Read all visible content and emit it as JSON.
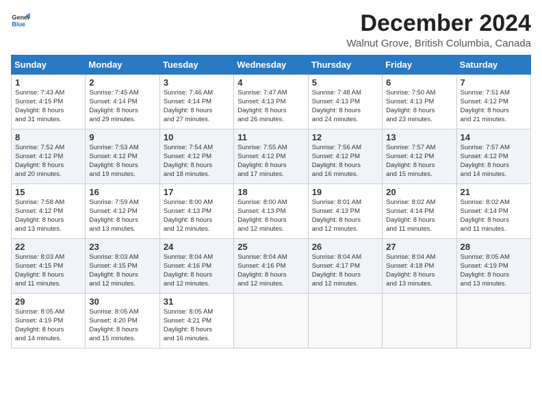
{
  "header": {
    "logo_line1": "General",
    "logo_line2": "Blue",
    "title": "December 2024",
    "subtitle": "Walnut Grove, British Columbia, Canada"
  },
  "days_of_week": [
    "Sunday",
    "Monday",
    "Tuesday",
    "Wednesday",
    "Thursday",
    "Friday",
    "Saturday"
  ],
  "weeks": [
    [
      {
        "day": 1,
        "lines": [
          "Sunrise: 7:43 AM",
          "Sunset: 4:15 PM",
          "Daylight: 8 hours",
          "and 31 minutes."
        ]
      },
      {
        "day": 2,
        "lines": [
          "Sunrise: 7:45 AM",
          "Sunset: 4:14 PM",
          "Daylight: 8 hours",
          "and 29 minutes."
        ]
      },
      {
        "day": 3,
        "lines": [
          "Sunrise: 7:46 AM",
          "Sunset: 4:14 PM",
          "Daylight: 8 hours",
          "and 27 minutes."
        ]
      },
      {
        "day": 4,
        "lines": [
          "Sunrise: 7:47 AM",
          "Sunset: 4:13 PM",
          "Daylight: 8 hours",
          "and 26 minutes."
        ]
      },
      {
        "day": 5,
        "lines": [
          "Sunrise: 7:48 AM",
          "Sunset: 4:13 PM",
          "Daylight: 8 hours",
          "and 24 minutes."
        ]
      },
      {
        "day": 6,
        "lines": [
          "Sunrise: 7:50 AM",
          "Sunset: 4:13 PM",
          "Daylight: 8 hours",
          "and 23 minutes."
        ]
      },
      {
        "day": 7,
        "lines": [
          "Sunrise: 7:51 AM",
          "Sunset: 4:12 PM",
          "Daylight: 8 hours",
          "and 21 minutes."
        ]
      }
    ],
    [
      {
        "day": 8,
        "lines": [
          "Sunrise: 7:52 AM",
          "Sunset: 4:12 PM",
          "Daylight: 8 hours",
          "and 20 minutes."
        ]
      },
      {
        "day": 9,
        "lines": [
          "Sunrise: 7:53 AM",
          "Sunset: 4:12 PM",
          "Daylight: 8 hours",
          "and 19 minutes."
        ]
      },
      {
        "day": 10,
        "lines": [
          "Sunrise: 7:54 AM",
          "Sunset: 4:12 PM",
          "Daylight: 8 hours",
          "and 18 minutes."
        ]
      },
      {
        "day": 11,
        "lines": [
          "Sunrise: 7:55 AM",
          "Sunset: 4:12 PM",
          "Daylight: 8 hours",
          "and 17 minutes."
        ]
      },
      {
        "day": 12,
        "lines": [
          "Sunrise: 7:56 AM",
          "Sunset: 4:12 PM",
          "Daylight: 8 hours",
          "and 16 minutes."
        ]
      },
      {
        "day": 13,
        "lines": [
          "Sunrise: 7:57 AM",
          "Sunset: 4:12 PM",
          "Daylight: 8 hours",
          "and 15 minutes."
        ]
      },
      {
        "day": 14,
        "lines": [
          "Sunrise: 7:57 AM",
          "Sunset: 4:12 PM",
          "Daylight: 8 hours",
          "and 14 minutes."
        ]
      }
    ],
    [
      {
        "day": 15,
        "lines": [
          "Sunrise: 7:58 AM",
          "Sunset: 4:12 PM",
          "Daylight: 8 hours",
          "and 13 minutes."
        ]
      },
      {
        "day": 16,
        "lines": [
          "Sunrise: 7:59 AM",
          "Sunset: 4:12 PM",
          "Daylight: 8 hours",
          "and 13 minutes."
        ]
      },
      {
        "day": 17,
        "lines": [
          "Sunrise: 8:00 AM",
          "Sunset: 4:13 PM",
          "Daylight: 8 hours",
          "and 12 minutes."
        ]
      },
      {
        "day": 18,
        "lines": [
          "Sunrise: 8:00 AM",
          "Sunset: 4:13 PM",
          "Daylight: 8 hours",
          "and 12 minutes."
        ]
      },
      {
        "day": 19,
        "lines": [
          "Sunrise: 8:01 AM",
          "Sunset: 4:13 PM",
          "Daylight: 8 hours",
          "and 12 minutes."
        ]
      },
      {
        "day": 20,
        "lines": [
          "Sunrise: 8:02 AM",
          "Sunset: 4:14 PM",
          "Daylight: 8 hours",
          "and 11 minutes."
        ]
      },
      {
        "day": 21,
        "lines": [
          "Sunrise: 8:02 AM",
          "Sunset: 4:14 PM",
          "Daylight: 8 hours",
          "and 11 minutes."
        ]
      }
    ],
    [
      {
        "day": 22,
        "lines": [
          "Sunrise: 8:03 AM",
          "Sunset: 4:15 PM",
          "Daylight: 8 hours",
          "and 11 minutes."
        ]
      },
      {
        "day": 23,
        "lines": [
          "Sunrise: 8:03 AM",
          "Sunset: 4:15 PM",
          "Daylight: 8 hours",
          "and 12 minutes."
        ]
      },
      {
        "day": 24,
        "lines": [
          "Sunrise: 8:04 AM",
          "Sunset: 4:16 PM",
          "Daylight: 8 hours",
          "and 12 minutes."
        ]
      },
      {
        "day": 25,
        "lines": [
          "Sunrise: 8:04 AM",
          "Sunset: 4:16 PM",
          "Daylight: 8 hours",
          "and 12 minutes."
        ]
      },
      {
        "day": 26,
        "lines": [
          "Sunrise: 8:04 AM",
          "Sunset: 4:17 PM",
          "Daylight: 8 hours",
          "and 12 minutes."
        ]
      },
      {
        "day": 27,
        "lines": [
          "Sunrise: 8:04 AM",
          "Sunset: 4:18 PM",
          "Daylight: 8 hours",
          "and 13 minutes."
        ]
      },
      {
        "day": 28,
        "lines": [
          "Sunrise: 8:05 AM",
          "Sunset: 4:19 PM",
          "Daylight: 8 hours",
          "and 13 minutes."
        ]
      }
    ],
    [
      {
        "day": 29,
        "lines": [
          "Sunrise: 8:05 AM",
          "Sunset: 4:19 PM",
          "Daylight: 8 hours",
          "and 14 minutes."
        ]
      },
      {
        "day": 30,
        "lines": [
          "Sunrise: 8:05 AM",
          "Sunset: 4:20 PM",
          "Daylight: 8 hours",
          "and 15 minutes."
        ]
      },
      {
        "day": 31,
        "lines": [
          "Sunrise: 8:05 AM",
          "Sunset: 4:21 PM",
          "Daylight: 8 hours",
          "and 16 minutes."
        ]
      },
      null,
      null,
      null,
      null
    ]
  ]
}
